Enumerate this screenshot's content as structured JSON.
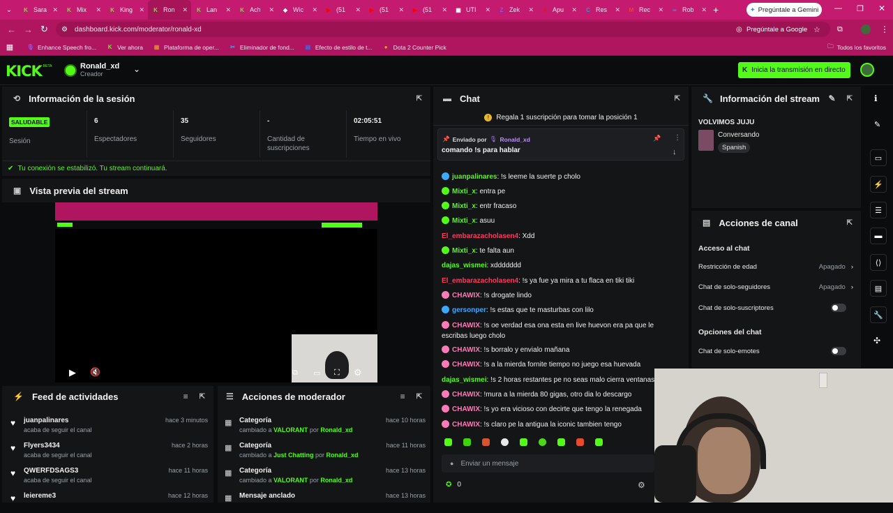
{
  "browser": {
    "tabs": [
      {
        "label": "Sara",
        "fav": "K",
        "color": "#53fc18"
      },
      {
        "label": "Mix",
        "fav": "K",
        "color": "#53fc18"
      },
      {
        "label": "King",
        "fav": "K",
        "color": "#53fc18"
      },
      {
        "label": "Ron",
        "fav": "K",
        "color": "#53fc18",
        "active": true
      },
      {
        "label": "Lan",
        "fav": "K",
        "color": "#53fc18"
      },
      {
        "label": "Ach",
        "fav": "K",
        "color": "#53fc18"
      },
      {
        "label": "Wic",
        "fav": "◆",
        "color": "#ffffff"
      },
      {
        "label": "(51",
        "fav": "▶",
        "color": "#ff0000"
      },
      {
        "label": "(51",
        "fav": "▶",
        "color": "#ff0000"
      },
      {
        "label": "(51",
        "fav": "▶",
        "color": "#ff0000"
      },
      {
        "label": "UTI",
        "fav": "▦",
        "color": "#ffffff"
      },
      {
        "label": "Zek",
        "fav": "Z",
        "color": "#7b5cff"
      },
      {
        "label": "Apu",
        "fav": "A",
        "color": "#d81b1b"
      },
      {
        "label": "Res",
        "fav": "C",
        "color": "#1aa0d8"
      },
      {
        "label": "Rec",
        "fav": "M",
        "color": "#ea4335"
      },
      {
        "label": "Rob",
        "fav": "∞",
        "color": "#1da1f2"
      }
    ],
    "gemini_button": "Pregúntale a Gemini",
    "url": "dashboard.kick.com/moderator/ronald-xd",
    "ask_google": "Pregúntale a Google",
    "bookmarks": [
      {
        "label": "Enhance Speech fro...",
        "ic": "🎙",
        "color": "#7b5cff"
      },
      {
        "label": "Ver ahora",
        "ic": "K",
        "color": "#53fc18"
      },
      {
        "label": "Plataforma de oper...",
        "ic": "▦",
        "color": "#e08a2b"
      },
      {
        "label": "Eliminador de fond...",
        "ic": "✂",
        "color": "#3ea8ff"
      },
      {
        "label": "Efecto de estilo de t...",
        "ic": "▤",
        "color": "#3a6df0"
      },
      {
        "label": "Dota 2 Counter Pick",
        "ic": "●",
        "color": "#e2a020"
      }
    ],
    "all_favorites": "Todos los favoritos"
  },
  "header": {
    "logo": "KICK",
    "logo_beta": "BETA",
    "user_name": "Ronald_xd",
    "user_role": "Creador",
    "start_stream": "Inicia la transmisión en directo"
  },
  "session": {
    "title": "Información de la sesión",
    "status_badge": "SALUDABLE",
    "status_label": "Sesión",
    "viewers_value": "6",
    "viewers_label": "Espectadores",
    "followers_value": "35",
    "followers_label": "Seguidores",
    "subs_value": "-",
    "subs_label": "Cantidad de suscripciones",
    "live_value": "02:05:51",
    "live_label": "Tiempo en vivo",
    "connection_msg": "Tu conexión se estabilizó. Tu stream continuará."
  },
  "preview": {
    "title": "Vista previa del stream"
  },
  "feed": {
    "title": "Feed de actividades",
    "items": [
      {
        "user": "juanpalinares",
        "action": "acaba de seguir el canal",
        "time": "hace 3 minutos"
      },
      {
        "user": "Flyers3434",
        "action": "acaba de seguir el canal",
        "time": "hace 2 horas"
      },
      {
        "user": "QWERFDSAGS3",
        "action": "acaba de seguir el canal",
        "time": "hace 11 horas"
      },
      {
        "user": "leiereme3",
        "action": "",
        "time": "hace 12 horas"
      }
    ]
  },
  "modactions": {
    "title": "Acciones de moderador",
    "items": [
      {
        "title": "Categoría",
        "pre": "cambiado a ",
        "cat": "VALORANT",
        "mid": " por ",
        "user": "Ronald_xd",
        "time": "hace 10 horas"
      },
      {
        "title": "Categoría",
        "pre": "cambiado a ",
        "cat": "Just Chatting",
        "mid": " por ",
        "user": "Ronald_xd",
        "time": "hace 11 horas"
      },
      {
        "title": "Categoría",
        "pre": "cambiado a ",
        "cat": "VALORANT",
        "mid": " por ",
        "user": "Ronald_xd",
        "time": "hace 13 horas"
      },
      {
        "title": "Mensaje anclado",
        "pre": "",
        "cat": "",
        "mid": "",
        "user": "",
        "time": "hace 13 horas"
      }
    ]
  },
  "chat": {
    "title": "Chat",
    "gift_banner": "Regala 1 suscripción para tomar la posición 1",
    "pinned_by_label": "Enviado por",
    "pinned_by_user": "Ronald_xd",
    "pinned_message": "comando !s para hablar",
    "messages": [
      {
        "user": "juanpalinares",
        "text": ": !s leeme la suerte p cholo",
        "color": "#53fc18",
        "badge": "#3ea8ff"
      },
      {
        "user": "Mixti_x",
        "text": ": entra pe",
        "color": "#53fc18",
        "badge": "#53fc18"
      },
      {
        "user": "Mixti_x",
        "text": ": entr fracaso",
        "color": "#53fc18",
        "badge": "#53fc18"
      },
      {
        "user": "Mixti_x",
        "text": ": asuu",
        "color": "#53fc18",
        "badge": "#53fc18"
      },
      {
        "user": "El_embarazacholasen4",
        "text": ": Xdd",
        "color": "#ff3b5c",
        "badge": ""
      },
      {
        "user": "Mixti_x",
        "text": ": te falta aun",
        "color": "#53fc18",
        "badge": "#53fc18"
      },
      {
        "user": "dajas_wismei",
        "text": ": xddddddd",
        "color": "#53fc18",
        "badge": ""
      },
      {
        "user": "El_embarazacholasen4",
        "text": ": !s ya fue ya mira a tu flaca en tiki tiki",
        "color": "#ff3b5c",
        "badge": ""
      },
      {
        "user": "CHAWIX",
        "text": ": !s drogate lindo",
        "color": "#ff7ab6",
        "badge": "#ff7ab6"
      },
      {
        "user": "gersonper",
        "text": ": !s estas que te masturbas con lilo",
        "color": "#3ea8ff",
        "badge": "#3ea8ff"
      },
      {
        "user": "CHAWIX",
        "text": ": !s oe verdad esa ona esta en live huevon era pa que le",
        "color": "#ff7ab6",
        "badge": "#ff7ab6"
      },
      {
        "user": "",
        "text": "escribas luego cholo",
        "color": "#ff7ab6",
        "badge": ""
      },
      {
        "user": "CHAWIX",
        "text": ": !s borralo y envialo mañana",
        "color": "#ff7ab6",
        "badge": "#ff7ab6"
      },
      {
        "user": "CHAWIX",
        "text": ": !s a la mierda fornite tiempo no juego esa huevada",
        "color": "#ff7ab6",
        "badge": "#ff7ab6"
      },
      {
        "user": "dajas_wismei",
        "text": ": !s 2 horas restantes pe no seas malo cierra ventanas",
        "color": "#53fc18",
        "badge": ""
      },
      {
        "user": "CHAWIX",
        "text": ": !mura a la mierda 80 gigas, otro dia lo descargo",
        "color": "#ff7ab6",
        "badge": "#ff7ab6"
      },
      {
        "user": "CHAWIX",
        "text": ": !s yo era vicioso con decirte que tengo la renegada",
        "color": "#ff7ab6",
        "badge": "#ff7ab6"
      },
      {
        "user": "CHAWIX",
        "text": ": !s claro pe la antigua la iconic tambien tengo",
        "color": "#ff7ab6",
        "badge": "#ff7ab6"
      }
    ],
    "input_placeholder": "Enviar un mensaje",
    "points": "0"
  },
  "stream_info": {
    "title": "Información del stream",
    "stream_title": "VOLVIMOS JUJU",
    "category": "Conversando",
    "language": "Spanish"
  },
  "channel_actions": {
    "title": "Acciones de canal",
    "section_chat_access": "Acceso al chat",
    "age_restriction": "Restricción de edad",
    "age_value": "Apagado",
    "followers_only": "Chat de solo-seguidores",
    "followers_value": "Apagado",
    "subs_only": "Chat de solo-suscriptores",
    "section_chat_options": "Opciones del chat",
    "emotes_only": "Chat de solo-emotes"
  },
  "colors": {
    "accent": "#53fc18",
    "browser": "#c41a6f"
  }
}
